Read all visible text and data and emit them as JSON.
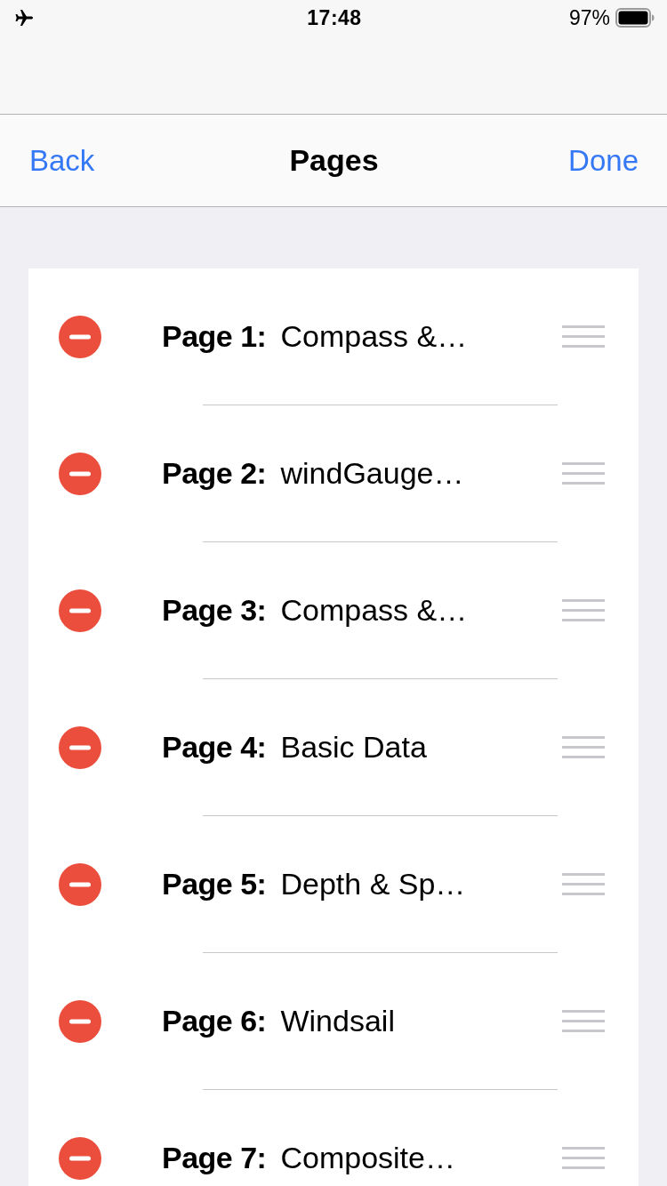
{
  "status_bar": {
    "time": "17:48",
    "battery": "97%"
  },
  "nav_bar": {
    "back": "Back",
    "title": "Pages",
    "done": "Done"
  },
  "pages": [
    {
      "number": "Page 1:",
      "title": "Compass &…"
    },
    {
      "number": "Page 2:",
      "title": "windGauge…"
    },
    {
      "number": "Page 3:",
      "title": "Compass &…"
    },
    {
      "number": "Page 4:",
      "title": "Basic Data"
    },
    {
      "number": "Page 5:",
      "title": "Depth & Sp…"
    },
    {
      "number": "Page 6:",
      "title": "Windsail"
    },
    {
      "number": "Page 7:",
      "title": "Composite…"
    }
  ]
}
